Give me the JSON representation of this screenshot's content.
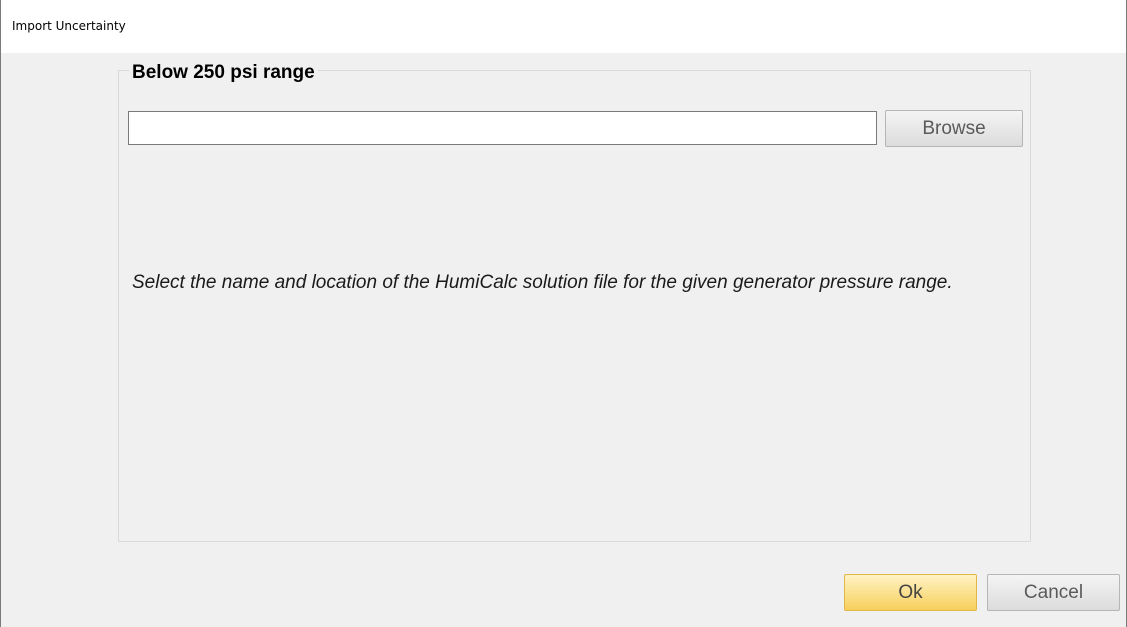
{
  "window": {
    "title": "Import Uncertainty"
  },
  "group": {
    "legend": "Below 250 psi range"
  },
  "file_input": {
    "value": "",
    "placeholder": ""
  },
  "buttons": {
    "browse": "Browse",
    "ok": "Ok",
    "cancel": "Cancel"
  },
  "hint_text": "Select the name and location of the HumiCalc solution file for the given generator pressure range.",
  "colors": {
    "ok_button_top": "#fff3c4",
    "ok_button_bottom": "#f7cf5b",
    "background": "#f0f0f0"
  }
}
